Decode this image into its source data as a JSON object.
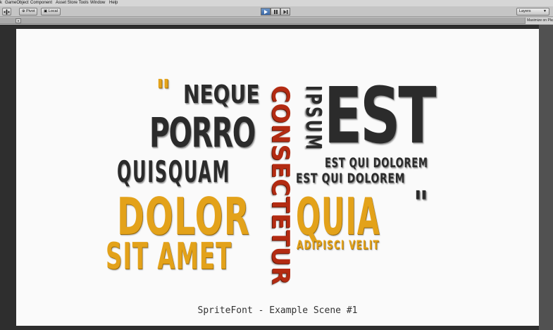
{
  "menu": {
    "leading": "k",
    "items": [
      "GameObject",
      "Component",
      "Asset Store Tools",
      "Window",
      "Help"
    ]
  },
  "toolbar": {
    "pivot_label": "Pivot",
    "local_label": "Local",
    "layers_label": "Layers",
    "play_state": "playing",
    "accent": "#3a68a8"
  },
  "gameview": {
    "maximize_label": "Maximize on Play"
  },
  "scene": {
    "words": {
      "quote_open": "\"",
      "neque": "NEQUE",
      "porro": "PORRO",
      "quisquam": "QUISQUAM",
      "consectetur": "CONSECTETUR",
      "ipsum": "IPSUM",
      "est": "EST",
      "est_qui_dolorem_1": "EST QUI DOLOREM",
      "est_qui_dolorem_2": "EST QUI DOLOREM",
      "dolor": "DOLOR",
      "quia": "QUIA",
      "quote_close": "\"",
      "sit_amet": "SIT AMET",
      "adipisci_velit": "ADIPISCI VELIT"
    },
    "colors": {
      "dark": "#2b2b2b",
      "red": "#b32b12",
      "gold": "#e3a21a",
      "background": "#fafafa"
    },
    "caption": "SpriteFont - Example Scene #1"
  }
}
